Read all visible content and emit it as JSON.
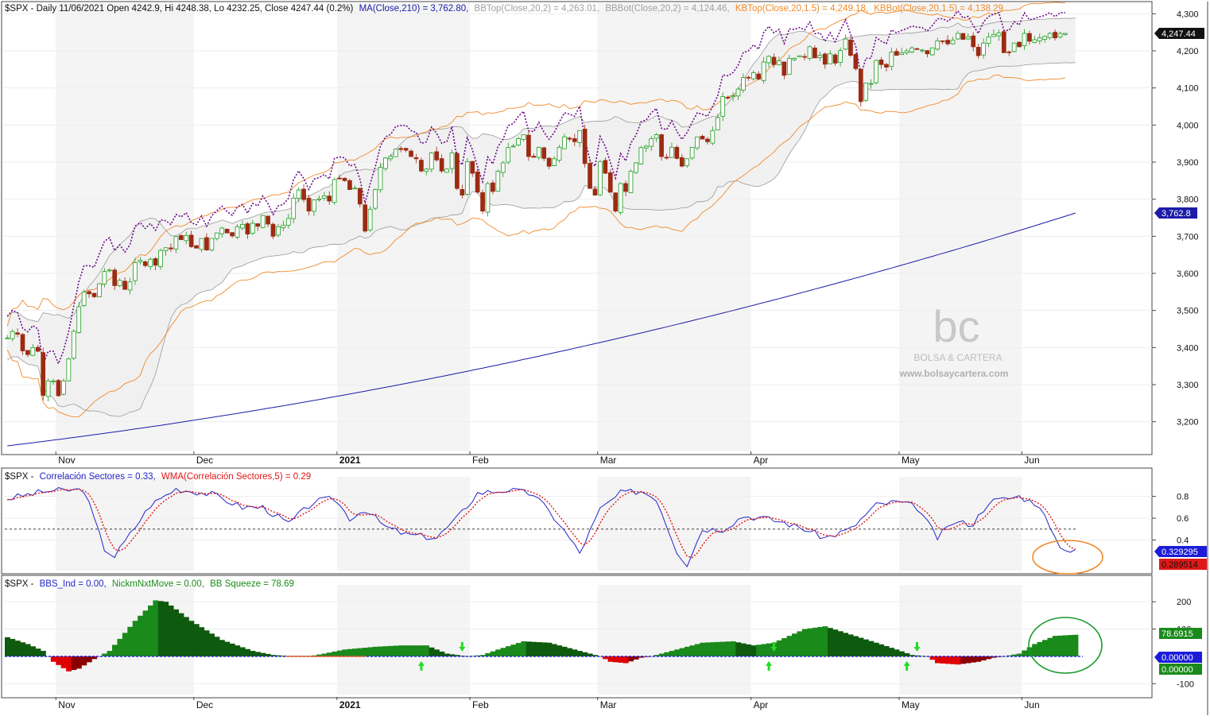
{
  "colors": {
    "up": "#1f9a1f",
    "down": "#9c2a12",
    "ma": "#1c1ca8",
    "bb": "#9a9a9a",
    "kb": "#f08a2a",
    "band_fill": "#efefef",
    "purple": "#6a0a8a",
    "corr": "#2424c8",
    "wma": "#e01818",
    "bbs_green": "#1a8a1a",
    "bbs_dark": "#0e5a0e",
    "bbs_red": "#e00000",
    "bbs_darkred": "#8a0000"
  },
  "header": {
    "main_prefix": "$SPX - Daily 11/06/2021 Open 4242.9, Hi 4248.38, Lo 4232.25, Close 4247.44 (0.2%)",
    "ma_label": "MA(Close,210) = 3,762.80,",
    "bbtop_label": "BBTop(Close,20,2) = 4,263.01,",
    "bbbot_label": "BBBot(Close,20,2) = 4,124.46,",
    "kbtop_label": "KBTop(Close,20,1.5) = 4,249.18,",
    "kbbot_label": "KBBot(Close,20,1.5) = 4,138.29",
    "corr_prefix": "$SPX -",
    "corr_label": "Correlación Sectores = 0.33,",
    "wma_label": "WMA(Correlación Sectores,5) = 0.29",
    "bbs_prefix": "$SPX -",
    "bbs_label": "BBS_Ind = 0.00,",
    "nick_label": "NickmNxtMove = 0.00,",
    "squeeze_label": "BB Squeeze = 78.69"
  },
  "badges": {
    "last_close": "4,247.44",
    "ma_value": "3,762.8",
    "corr_value": "0.329295",
    "wma_value": "0.289514",
    "squeeze_value": "78.6915",
    "bbs_value": "0.00000",
    "nick_value": "0.00000"
  },
  "watermark": {
    "logo": "bc",
    "name": "BOLSA & CARTERA",
    "url": "www.bolsaycartera.com"
  },
  "chart_data": [
    {
      "type": "candlestick",
      "name": "price",
      "ylim": [
        3120,
        4320
      ],
      "yticks": [
        3200,
        3300,
        3400,
        3500,
        3600,
        3700,
        3800,
        3900,
        4000,
        4100,
        4200,
        4300
      ],
      "ytick_labels": [
        "3,200",
        "3,300",
        "3,400",
        "3,500",
        "3,600",
        "3,700",
        "3,800",
        "3,900",
        "4,000",
        "4,100",
        "4,200",
        "4,300"
      ],
      "x_months": [
        "Nov",
        "Dec",
        "2021",
        "Feb",
        "Mar",
        "Apr",
        "May",
        "Jun"
      ],
      "month_start_index": [
        10,
        37,
        65,
        91,
        116,
        146,
        175,
        199
      ],
      "n_bars": 210,
      "note_dates": "trading days from 2020-10-19 to 2021-06-11",
      "close": [
        3426,
        3443,
        3436,
        3391,
        3381,
        3400,
        3390,
        3271,
        3310,
        3310,
        3270,
        3310,
        3369,
        3444,
        3510,
        3550,
        3545,
        3537,
        3572,
        3605,
        3609,
        3567,
        3581,
        3557,
        3577,
        3629,
        3635,
        3621,
        3638,
        3622,
        3662,
        3669,
        3666,
        3699,
        3691,
        3702,
        3672,
        3668,
        3694,
        3663,
        3694,
        3709,
        3722,
        3709,
        3701,
        3726,
        3732,
        3706,
        3735,
        3727,
        3756,
        3733,
        3700,
        3726,
        3730,
        3748,
        3803,
        3825,
        3799,
        3768,
        3798,
        3801,
        3809,
        3795,
        3853,
        3855,
        3850,
        3826,
        3830,
        3787,
        3714,
        3773,
        3826,
        3886,
        3911,
        3916,
        3935,
        3934,
        3932,
        3915,
        3909,
        3876,
        3881,
        3925,
        3906,
        3876,
        3881,
        3925,
        3829,
        3811,
        3901,
        3870,
        3819,
        3768,
        3842,
        3821,
        3875,
        3898,
        3939,
        3943,
        3963,
        3974,
        3915,
        3913,
        3940,
        3910,
        3889,
        3909,
        3940,
        3968,
        3962,
        3955,
        3985,
        3896,
        3829,
        3811,
        3901,
        3870,
        3819,
        3768,
        3842,
        3821,
        3875,
        3898,
        3939,
        3943,
        3963,
        3974,
        3915,
        3913,
        3940,
        3910,
        3889,
        3909,
        3940,
        3968,
        3962,
        3955,
        3985,
        4020,
        4077,
        4073,
        4079,
        4097,
        4128,
        4128,
        4141,
        4124,
        4170,
        4185,
        4163,
        4173,
        4134,
        4180,
        4180,
        4187,
        4183,
        4211,
        4181,
        4188,
        4164,
        4192,
        4167,
        4201,
        4232,
        4188,
        4152,
        4063,
        4113,
        4112,
        4174,
        4163,
        4156,
        4197,
        4188,
        4195,
        4200,
        4208,
        4204,
        4202,
        4192,
        4208,
        4227,
        4226,
        4219,
        4229,
        4247,
        4231,
        4238,
        4211,
        4187,
        4221,
        4237,
        4244,
        4248,
        4195,
        4195,
        4221,
        4211,
        4247,
        4226,
        4230,
        4235,
        4239,
        4247,
        4235,
        4247,
        4247
      ],
      "legend": [
        "MA(Close,210)",
        "BBTop(Close,20,2)",
        "BBBot(Close,20,2)",
        "KBTop(Close,20,1.5)",
        "KBBot(Close,20,1.5)"
      ]
    },
    {
      "type": "line",
      "name": "correlacion",
      "ylim": [
        0.12,
        0.95
      ],
      "yticks": [
        0.4,
        0.6,
        0.8
      ],
      "ytick_labels": [
        "0.4",
        "0.6",
        "0.8"
      ],
      "reference_level": 0.5,
      "series": [
        {
          "name": "Correlación Sectores",
          "last": 0.33
        },
        {
          "name": "WMA(Correlación Sectores,5)",
          "last": 0.29
        }
      ]
    },
    {
      "type": "bar",
      "name": "bbs",
      "ylim": [
        -140,
        250
      ],
      "yticks": [
        -100,
        100,
        200
      ],
      "ytick_labels": [
        "-100",
        "100",
        "200"
      ],
      "series": [
        {
          "name": "BBS_Ind",
          "last": 0.0
        },
        {
          "name": "NickmNxtMove",
          "last": 0.0
        },
        {
          "name": "BB Squeeze",
          "last": 78.69
        }
      ]
    }
  ]
}
